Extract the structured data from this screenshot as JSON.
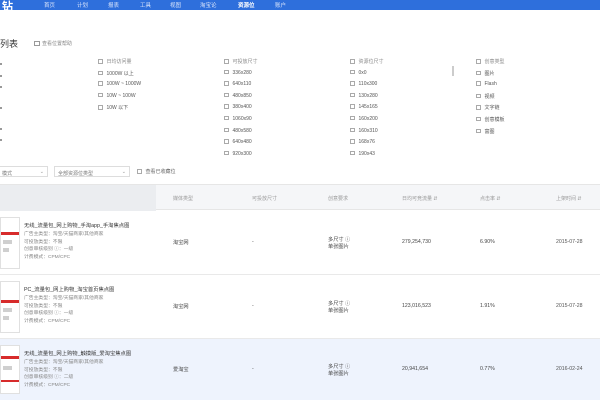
{
  "app": {
    "logo": "钻"
  },
  "nav": [
    "首页",
    "计划",
    "报表",
    "工具",
    "视图",
    "淘宝论",
    "资源位",
    "账户"
  ],
  "nav_active_index": 6,
  "page": {
    "title": "列表",
    "help_link": "查看位置帮助"
  },
  "filters": {
    "left_stub": [
      "·",
      "·",
      "·",
      "·",
      "·",
      "·"
    ],
    "traffic": {
      "header": "日均访问量",
      "options": [
        "1000W 以上",
        "100W ~ 1000W",
        "10W ~ 100W",
        "10W 以下"
      ]
    },
    "size": {
      "header": "可投放尺寸",
      "options": [
        "336x280",
        "640x110",
        "480x850",
        "380x400",
        "1060x90",
        "480x580",
        "640x480",
        "920x300"
      ]
    },
    "resource_size": {
      "header": "资源位尺寸",
      "options": [
        "0x0",
        "110x300",
        "130x280",
        "145x165",
        "160x200",
        "160x310",
        "168x76",
        "190x43"
      ]
    },
    "creative_type": {
      "header": "创意类型",
      "options": [
        "图片",
        "Flash",
        "视频",
        "文字链",
        "创意模板",
        "富图"
      ]
    }
  },
  "selects": {
    "mode": "模式",
    "resource_type": "全部资源位类型",
    "collected_label": "查看已收藏位"
  },
  "table": {
    "headers": [
      "媒体类型",
      "可投放尺寸",
      "创意要求",
      "日均可竞流量 ⇵",
      "点击率 ⇵",
      "上架时间 ⇵"
    ],
    "rows": [
      {
        "title": "无线_流量包_网上购物_手淘app_手淘焦点图",
        "meta": [
          "广告主类型：淘宝/天猫商家/其他商家",
          "可投放类型：不限",
          "创意审核级别 ⓘ：一级",
          "计费模式：CPM/CPC"
        ],
        "media": "淘宝网",
        "size": "-",
        "creative": [
          "多尺寸 ⓘ",
          "单张图片"
        ],
        "traffic": "279,254,730",
        "ctr": "6.90%",
        "date": "2015-07-28"
      },
      {
        "title": "PC_流量包_网上购物_淘宝首页焦点图",
        "meta": [
          "广告主类型：淘宝/天猫商家/其他商家",
          "可投放类型：不限",
          "创意审核级别 ⓘ：一级",
          "计费模式：CPM/CPC"
        ],
        "media": "淘宝网",
        "size": "-",
        "creative": [
          "多尺寸 ⓘ",
          "单张图片"
        ],
        "traffic": "123,016,523",
        "ctr": "1.91%",
        "date": "2015-07-28"
      },
      {
        "title": "无线_流量包_网上购物_触摸版_爱淘宝焦点图",
        "meta": [
          "广告主类型：淘宝/天猫商家/其他商家",
          "可投放类型：不限",
          "创意审核级别 ⓘ：二级",
          "计费模式：CPM/CPC"
        ],
        "media": "爱淘宝",
        "size": "-",
        "creative": [
          "多尺寸 ⓘ",
          "单张图片"
        ],
        "traffic": "20,941,654",
        "ctr": "0.77%",
        "date": "2016-02-24"
      }
    ]
  },
  "colors": {
    "topbar": "#2e6fdc",
    "highlight_row": "#eef3fd",
    "header_bg": "#f5f6f8",
    "accent_red": "#d72b2b"
  }
}
